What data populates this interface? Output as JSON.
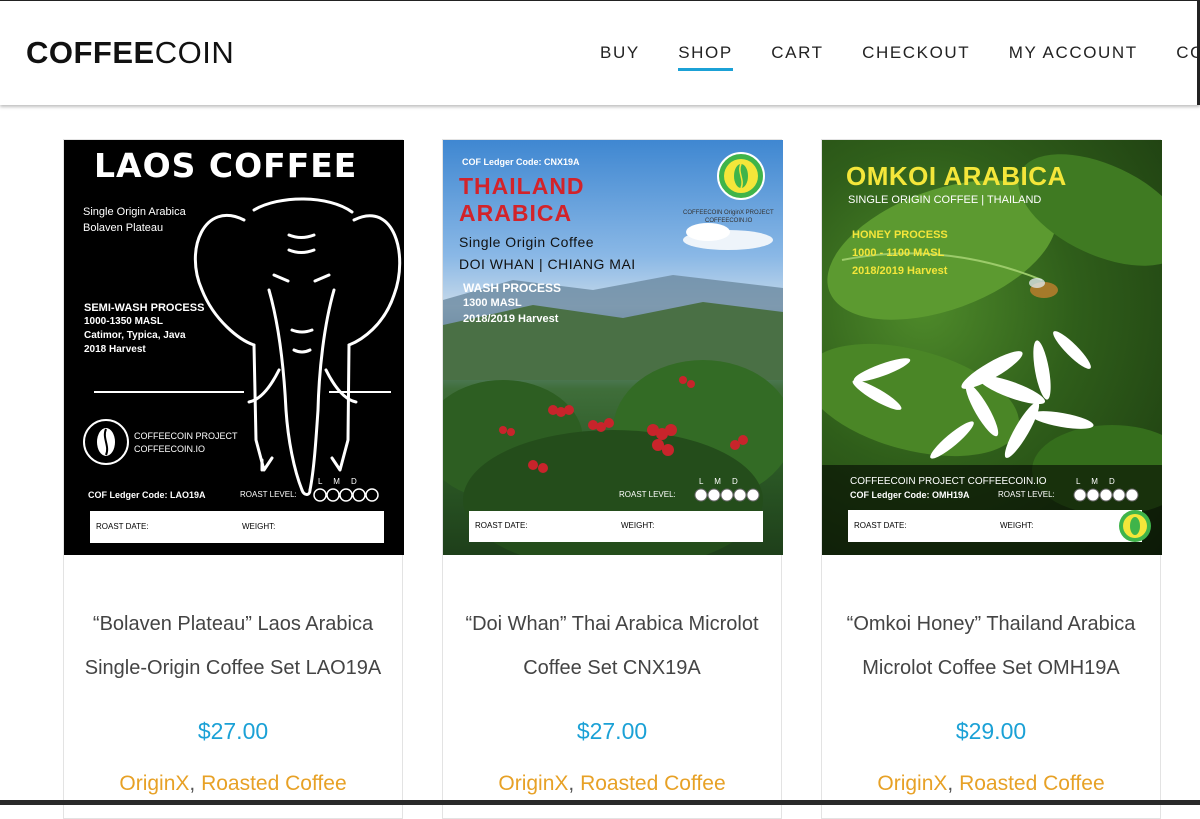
{
  "header": {
    "logo_bold": "COFFEE",
    "logo_light": "COIN",
    "nav": [
      "BUY",
      "SHOP",
      "CART",
      "CHECKOUT",
      "MY ACCOUNT",
      "CONTAC"
    ]
  },
  "colors": {
    "accent": "#1ba1d6",
    "category": "#e7a126",
    "logo_green": "#3fb44a",
    "label_yellow": "#f4e63a",
    "label_red": "#d2232a"
  },
  "products": [
    {
      "title_line1": "“Bolaven Plateau” Laos Arabica",
      "title_line2": "Single-Origin Coffee Set LAO19A",
      "price": "$27.00",
      "cat1": "OriginX",
      "cat2": "Roasted Coffee",
      "label": {
        "heading": "LAOS COFFEE",
        "sub1": "Single Origin Arabica",
        "sub2": "Bolaven Plateau",
        "p1": "SEMI-WASH PROCESS",
        "p2": "1000-1350 MASL",
        "p3": "Catimor, Typica, Java",
        "p4": "2018 Harvest",
        "project1": "COFFEECOIN  PROJECT",
        "project2": "COFFEECOIN.IO",
        "ledger": "COF Ledger Code: LAO19A",
        "roast": "ROAST LEVEL:",
        "lmd": "L     M     D",
        "roast_date": "ROAST DATE:",
        "weight": "WEIGHT:"
      }
    },
    {
      "title_line1": "“Doi Whan” Thai Arabica Microlot",
      "title_line2": "Coffee Set CNX19A",
      "price": "$27.00",
      "cat1": "OriginX",
      "cat2": "Roasted Coffee",
      "label": {
        "ledger": "COF Ledger Code: CNX19A",
        "heading1": "THAILAND",
        "heading2": "ARABICA",
        "sub1": "Single Origin Coffee",
        "sub2": "DOI WHAN | CHIANG MAI",
        "p1": "WASH PROCESS",
        "p2": "1300 MASL",
        "p3": "2018/2019 Harvest",
        "project1": "COFFEECOIN OriginX PROJECT",
        "project2": "COFFEECOIN.IO",
        "roast": "ROAST LEVEL:",
        "lmd": "L     M     D",
        "roast_date": "ROAST DATE:",
        "weight": "WEIGHT:"
      }
    },
    {
      "title_line1": "“Omkoi Honey” Thailand Arabica",
      "title_line2": "Microlot Coffee Set OMH19A",
      "price": "$29.00",
      "cat1": "OriginX",
      "cat2": "Roasted Coffee",
      "label": {
        "heading": "OMKOI ARABICA",
        "sub": "SINGLE ORIGIN COFFEE | THAILAND",
        "p1": "HONEY PROCESS",
        "p2": "1000 - 1100 MASL",
        "p3": "2018/2019 Harvest",
        "project": "COFFEECOIN PROJECT COFFEECOIN.IO",
        "ledger": "COF Ledger Code: OMH19A",
        "roast": "ROAST LEVEL:",
        "lmd": "L     M     D",
        "roast_date": "ROAST DATE:",
        "weight": "WEIGHT:"
      }
    }
  ]
}
